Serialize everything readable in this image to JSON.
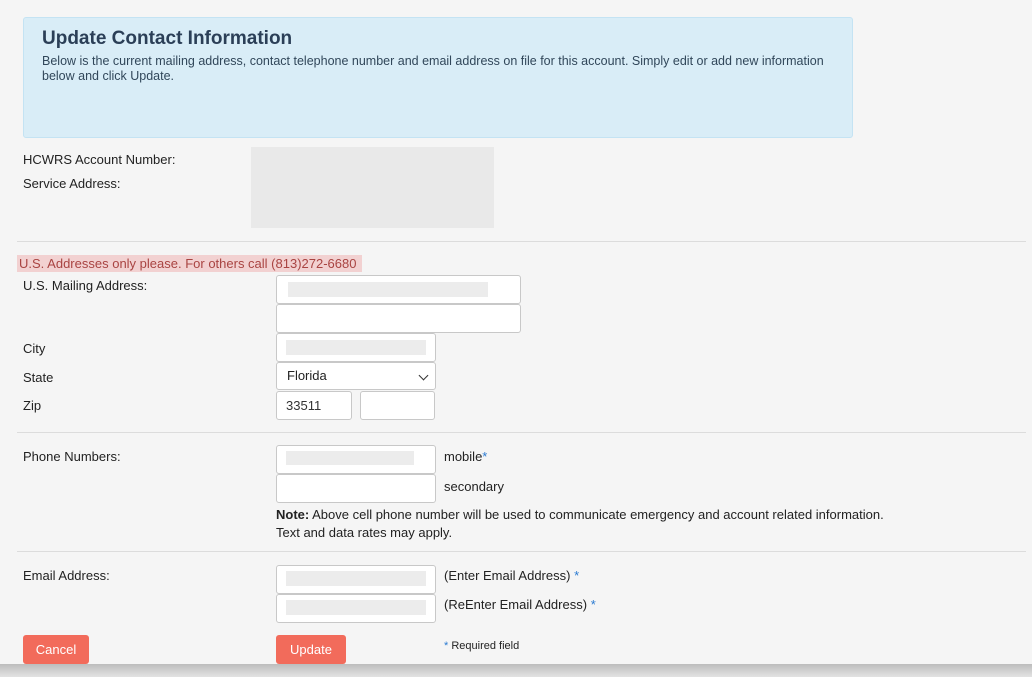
{
  "header": {
    "title": "Update Contact Information",
    "description": "Below is the current mailing address, contact telephone number and email address on file for this account. Simply edit or add new information below and click Update."
  },
  "account": {
    "account_number_label": "HCWRS Account Number:",
    "service_address_label": "Service Address:"
  },
  "address": {
    "warning": "U.S. Addresses only please. For others call (813)272-6680",
    "mailing_label": "U.S. Mailing Address:",
    "line1_value": "",
    "line2_value": "",
    "city_label": "City",
    "city_value": "",
    "state_label": "State",
    "state_value": "Florida",
    "zip_label": "Zip",
    "zip_value": "33511",
    "zip_ext_value": ""
  },
  "phone": {
    "label": "Phone Numbers:",
    "mobile_value": "",
    "mobile_caption": "mobile",
    "secondary_value": "",
    "secondary_caption": "secondary",
    "note_bold": "Note:",
    "note_text": " Above cell phone number will be used to communicate emergency and account related information.",
    "note_text2": "Text and data rates may apply."
  },
  "email": {
    "label": "Email Address:",
    "email_value": "",
    "email_caption": "(Enter Email Address)",
    "confirm_value": "",
    "confirm_caption": "(ReEnter Email Address)"
  },
  "actions": {
    "cancel_label": "Cancel",
    "update_label": "Update",
    "required_asterisk": "*",
    "required_note": "Required field"
  },
  "colors": {
    "button": "#f26b5b",
    "info_bg": "#d9edf7",
    "warning_bg": "#f2d1d1",
    "warning_text": "#a94442",
    "required": "#2a7ad1"
  }
}
